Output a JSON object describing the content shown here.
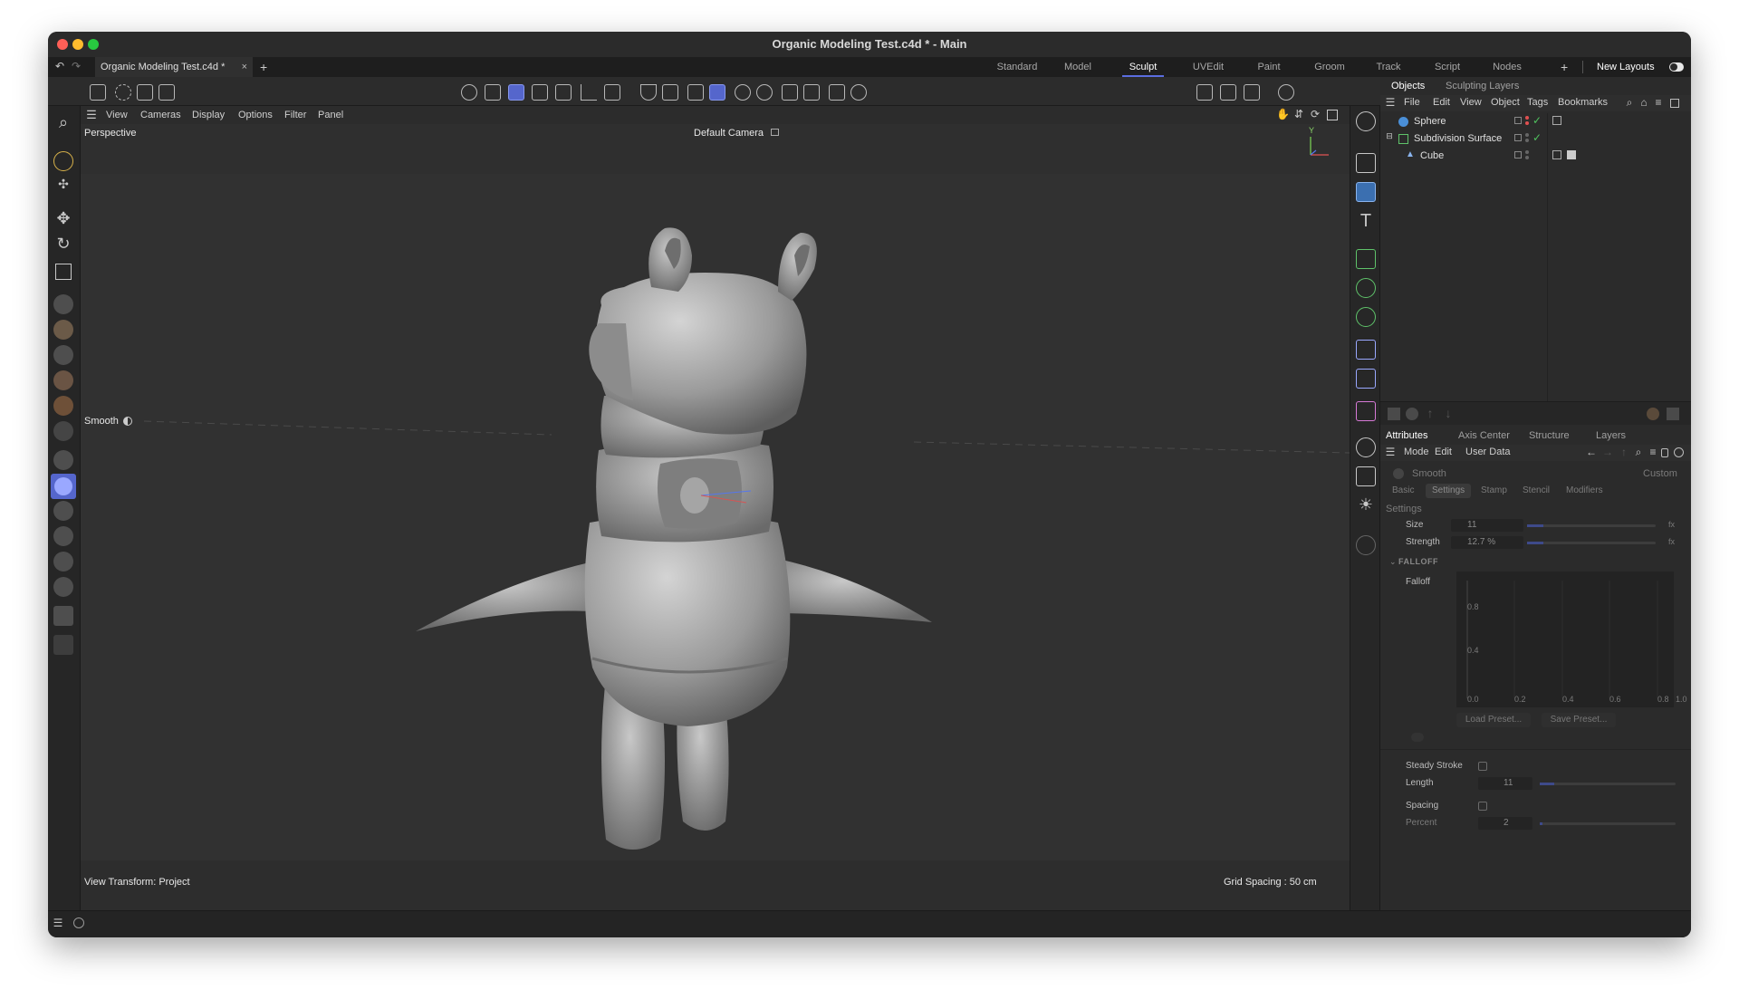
{
  "window": {
    "title": "Organic Modeling Test.c4d * - Main"
  },
  "tabs": {
    "document_tab": "Organic Modeling Test.c4d *",
    "close_glyph": "×",
    "add_glyph": "+",
    "layouts": [
      "Standard",
      "Model",
      "Sculpt",
      "UVEdit",
      "Paint",
      "Groom",
      "Track",
      "Script",
      "Nodes"
    ],
    "active_layout": "Sculpt",
    "layouts_add": "+",
    "new_layouts": "New Layouts"
  },
  "viewport_menu": {
    "items": [
      "View",
      "Cameras",
      "Display",
      "Options",
      "Filter",
      "Panel"
    ]
  },
  "viewport": {
    "projection": "Perspective",
    "camera": "Default Camera",
    "axis_y": "Y",
    "brush_label": "Smooth",
    "view_transform": "View Transform: Project",
    "grid_spacing": "Grid Spacing : 50 cm"
  },
  "objects_panel": {
    "tabs": [
      "Objects",
      "Sculpting Layers"
    ],
    "menu": [
      "File",
      "Edit",
      "View",
      "Object",
      "Tags",
      "Bookmarks"
    ],
    "rows": [
      {
        "name": "Sphere"
      },
      {
        "name": "Subdivision Surface"
      },
      {
        "name": "Cube"
      }
    ]
  },
  "attributes_panel": {
    "tabs": [
      "Attributes",
      "Axis Center",
      "Structure",
      "Layers"
    ],
    "menu": [
      "Mode",
      "Edit",
      "User Data"
    ],
    "tool_name": "Smooth",
    "preset": "Custom",
    "subtabs": [
      "Basic",
      "Settings",
      "Stamp",
      "Stencil",
      "Modifiers"
    ],
    "active_subtab": "Settings",
    "section_title": "Settings",
    "size_label": "Size",
    "size_value": "11",
    "strength_label": "Strength",
    "strength_value": "12.7 %",
    "fx": "fx",
    "falloff_section": "FALLOFF",
    "falloff_label": "Falloff",
    "graph_y_ticks": [
      "0.8",
      "0.4"
    ],
    "graph_x_ticks": [
      "0.0",
      "0.2",
      "0.4",
      "0.6",
      "0.8",
      "1.0"
    ],
    "load_preset": "Load Preset...",
    "save_preset": "Save Preset...",
    "steady_stroke_label": "Steady Stroke",
    "length_label": "Length",
    "length_value": "11",
    "spacing_label": "Spacing",
    "percent_label": "Percent",
    "percent_value": "2"
  },
  "colors": {
    "accent": "#5566cc",
    "check_green": "#4fc35e",
    "dot_red": "#e05050"
  }
}
